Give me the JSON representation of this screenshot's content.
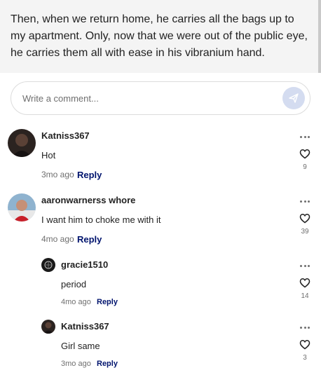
{
  "story": {
    "excerpt": "Then, when we return home, he carries all the bags up to my apartment. Only, now that we were out of the public eye, he carries them all with ease in his vibranium hand."
  },
  "comment_box": {
    "placeholder": "Write a comment..."
  },
  "comments": [
    {
      "username": "Katniss367",
      "text": "Hot",
      "time": "3mo ago",
      "reply_label": "Reply",
      "likes": "9",
      "reply": false
    },
    {
      "username": "aaronwarnerss whore",
      "text": "I want him to choke me with it",
      "time": "4mo ago",
      "reply_label": "Reply",
      "likes": "39",
      "reply": false
    },
    {
      "username": "gracie1510",
      "text": "period",
      "time": "4mo ago",
      "reply_label": "Reply",
      "likes": "14",
      "reply": true
    },
    {
      "username": "Katniss367",
      "text": "Girl same",
      "time": "3mo ago",
      "reply_label": "Reply",
      "likes": "3",
      "reply": true
    }
  ],
  "icons": {
    "send": "send-icon",
    "like": "heart-icon",
    "more": "more-options-icon"
  },
  "colors": {
    "reply_link": "#00146e",
    "send_button": "#d4dcf0",
    "excerpt_background": "#f4f4f4"
  }
}
